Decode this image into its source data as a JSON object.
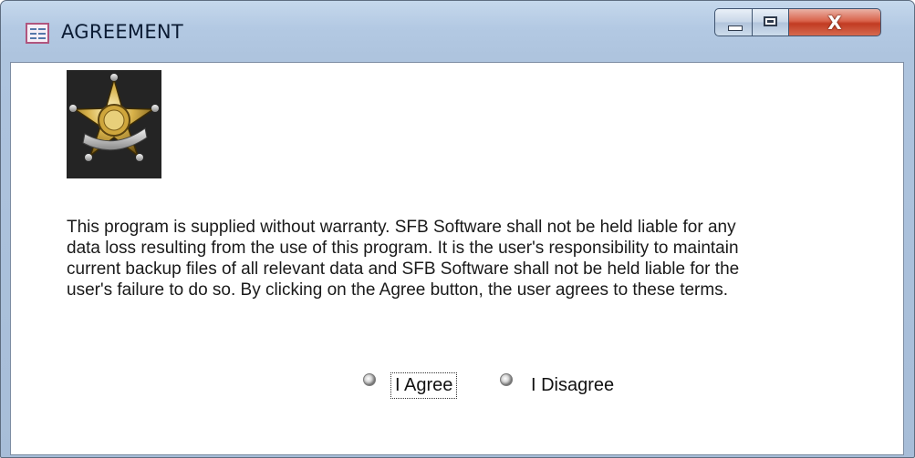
{
  "window": {
    "title": "AGREEMENT",
    "close_glyph": "X",
    "icon": "form-icon"
  },
  "content": {
    "logo_icon": "sheriff-star-badge-icon",
    "terms_lines": [
      "This program is supplied without warranty.  SFB Software shall not be held liable for any",
      "data loss resulting from the use of this  program.  It is the user's responsibility to  maintain",
      "current backup files of all relevant data and SFB Software shall not be held liable for the",
      "user's failure to do so.  By clicking on the Agree button, the user agrees to these terms."
    ]
  },
  "options": {
    "agree_label": "I Agree",
    "disagree_label": "I Disagree",
    "focused": "I Agree"
  },
  "colors": {
    "close_button": "#c13b22",
    "frame": "#b3c9e3"
  }
}
